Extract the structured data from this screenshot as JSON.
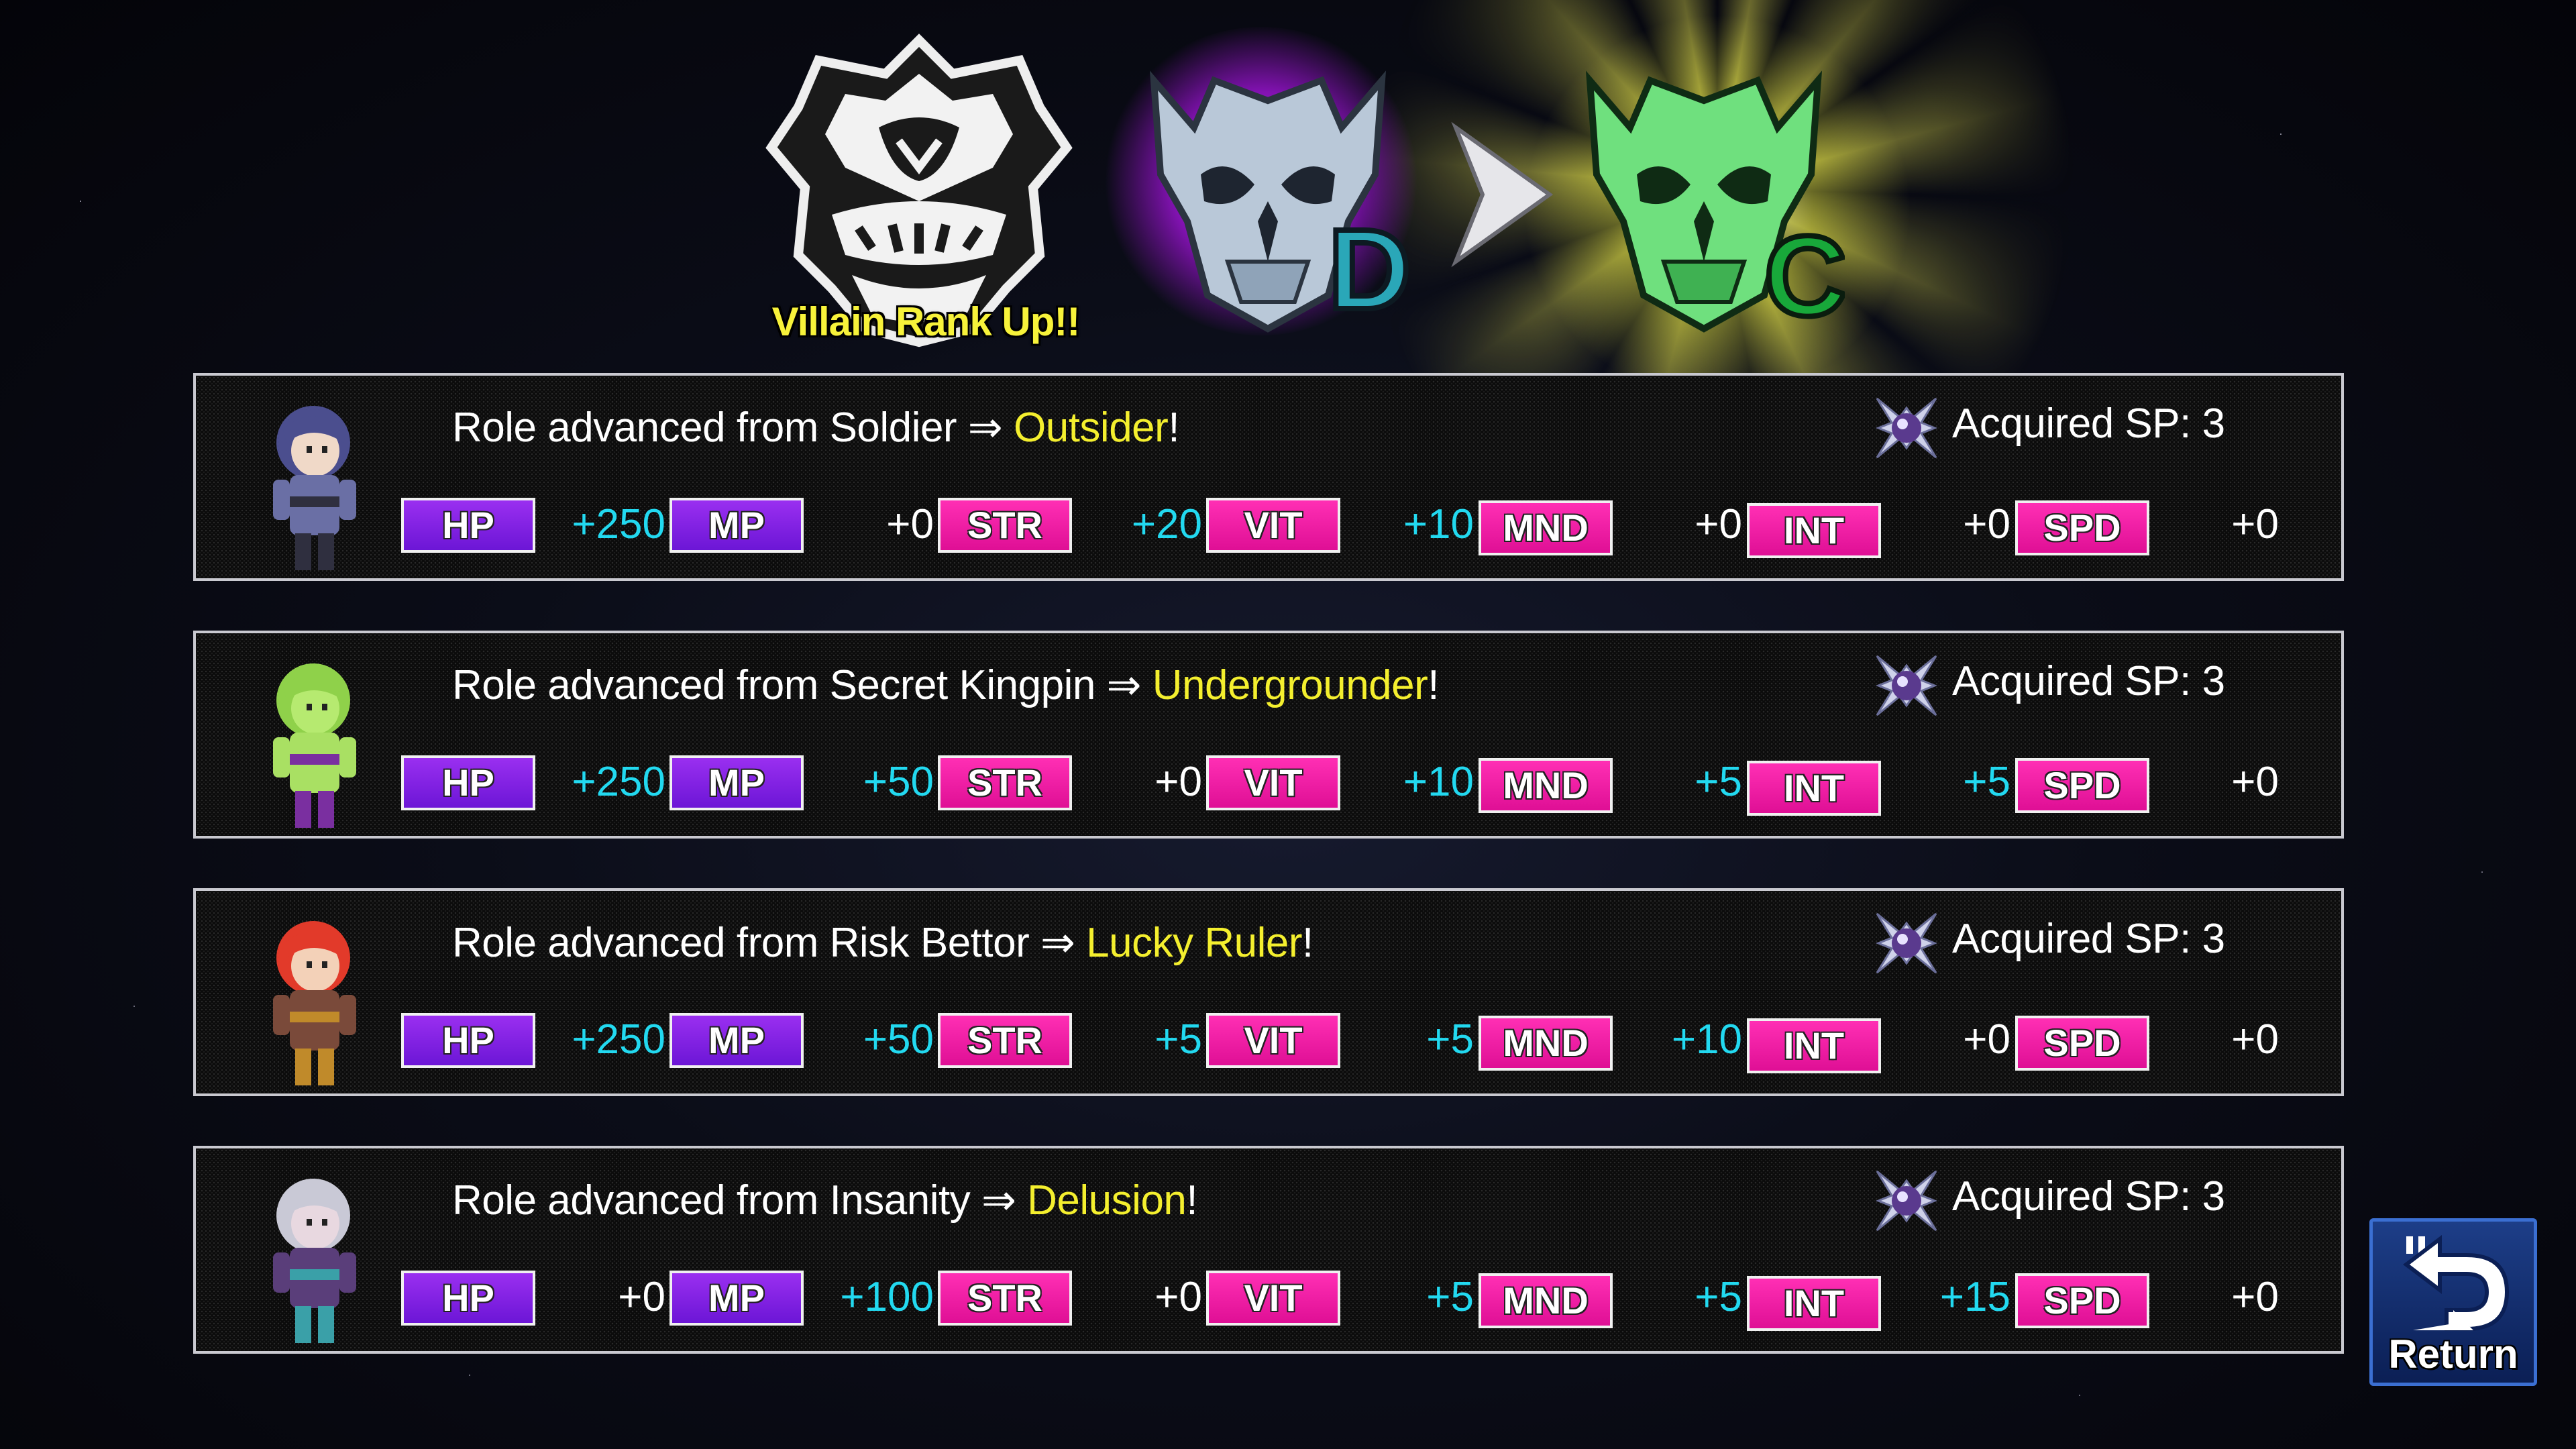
{
  "header": {
    "rank_up_text": "Villain Rank Up!!",
    "old_rank": "D",
    "new_rank": "C"
  },
  "rows": [
    {
      "from_prefix": "Role advanced from Soldier ⇒ ",
      "new_role": "Outsider",
      "suffix": "!",
      "sp_text": "Acquired SP: 3",
      "stats": [
        {
          "label": "HP",
          "value": "+250"
        },
        {
          "label": "MP",
          "value": "+0"
        },
        {
          "label": "STR",
          "value": "+20"
        },
        {
          "label": "VIT",
          "value": "+10"
        },
        {
          "label": "MND",
          "value": "+0"
        },
        {
          "label": "INT",
          "value": "+0"
        },
        {
          "label": "SPD",
          "value": "+0"
        }
      ]
    },
    {
      "from_prefix": "Role advanced from Secret Kingpin ⇒ ",
      "new_role": "Undergrounder",
      "suffix": "!",
      "sp_text": "Acquired SP: 3",
      "stats": [
        {
          "label": "HP",
          "value": "+250"
        },
        {
          "label": "MP",
          "value": "+50"
        },
        {
          "label": "STR",
          "value": "+0"
        },
        {
          "label": "VIT",
          "value": "+10"
        },
        {
          "label": "MND",
          "value": "+5"
        },
        {
          "label": "INT",
          "value": "+5"
        },
        {
          "label": "SPD",
          "value": "+0"
        }
      ]
    },
    {
      "from_prefix": "Role advanced from Risk Bettor ⇒ ",
      "new_role": "Lucky Ruler",
      "suffix": "!",
      "sp_text": "Acquired SP: 3",
      "stats": [
        {
          "label": "HP",
          "value": "+250"
        },
        {
          "label": "MP",
          "value": "+50"
        },
        {
          "label": "STR",
          "value": "+5"
        },
        {
          "label": "VIT",
          "value": "+5"
        },
        {
          "label": "MND",
          "value": "+10"
        },
        {
          "label": "INT",
          "value": "+0"
        },
        {
          "label": "SPD",
          "value": "+0"
        }
      ]
    },
    {
      "from_prefix": "Role advanced from Insanity ⇒ ",
      "new_role": "Delusion",
      "suffix": "!",
      "sp_text": "Acquired SP: 3",
      "stats": [
        {
          "label": "HP",
          "value": "+0"
        },
        {
          "label": "MP",
          "value": "+100"
        },
        {
          "label": "STR",
          "value": "+0"
        },
        {
          "label": "VIT",
          "value": "+5"
        },
        {
          "label": "MND",
          "value": "+5"
        },
        {
          "label": "INT",
          "value": "+15"
        },
        {
          "label": "SPD",
          "value": "+0"
        }
      ]
    }
  ],
  "return_button": {
    "label": "Return"
  },
  "colors": {
    "highlight_yellow": "#f4ef2e",
    "stat_plus_cyan": "#22d9f0",
    "badge_purple": "#8a22e8",
    "badge_pink": "#f01fa8"
  },
  "icons": {
    "sp": "sp-crystal-icon",
    "return": "return-arrow-icon"
  }
}
